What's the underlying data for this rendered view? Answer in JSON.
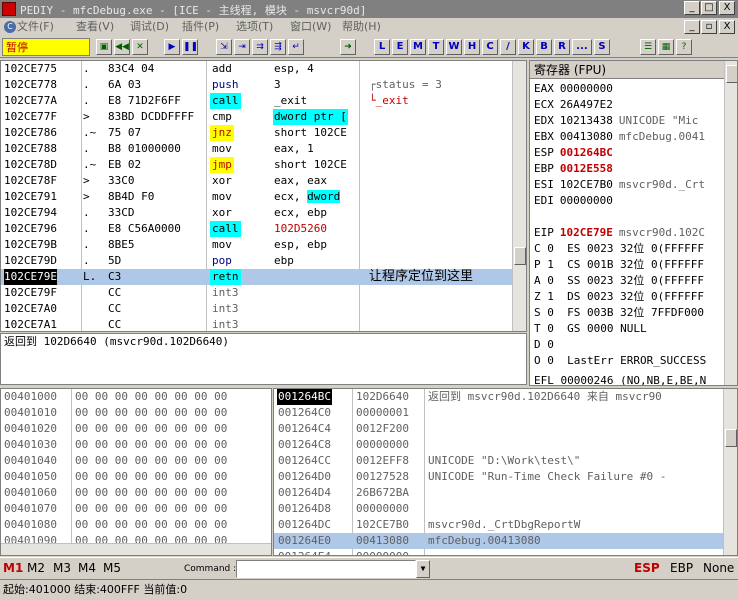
{
  "title": "PEDIY - mfcDebug.exe - [ICE - 主线程, 模块 - msvcr90d]",
  "window_buttons": [
    "_",
    "□",
    "X"
  ],
  "child_buttons": [
    "_",
    "▫",
    "X"
  ],
  "menu": [
    {
      "icon": "C",
      "label": "文件(F)"
    },
    {
      "icon": "",
      "label": "查看(V)"
    },
    {
      "icon": "",
      "label": "调试(D)"
    },
    {
      "icon": "",
      "label": "插件(P)"
    },
    {
      "icon": "",
      "label": "选项(T)"
    },
    {
      "icon": "",
      "label": "窗口(W)"
    },
    {
      "icon": "",
      "label": "帮助(H)"
    }
  ],
  "status": "暂停",
  "toolbar_letters": [
    "L",
    "E",
    "M",
    "T",
    "W",
    "H",
    "C",
    "/",
    "K",
    "B",
    "R",
    "...",
    "S"
  ],
  "disasm": [
    {
      "addr": "102CE775",
      "mk": ".",
      "hex": "83C4 04",
      "mn": "add",
      "op": "esp, 4",
      "mc": "plain",
      "oc": "",
      "cm": ""
    },
    {
      "addr": "102CE778",
      "mk": ".",
      "hex": "6A 03",
      "mn": "push",
      "op": "3",
      "mc": "push",
      "oc": "",
      "cm": "┌status = 3"
    },
    {
      "addr": "102CE77A",
      "mk": ".",
      "hex": "E8 71D2F6FF",
      "mn": "call",
      "op": "_exit",
      "mc": "call",
      "oc": "",
      "cm": "└_exit"
    },
    {
      "addr": "102CE77F",
      "mk": ">",
      "hex": "83BD DCDDFFFF",
      "mn": "cmp",
      "op": "dword ptr [",
      "mc": "plain",
      "oc": "hl",
      "cm": ""
    },
    {
      "addr": "102CE786",
      "mk": ".~",
      "hex": "75 07",
      "mn": "jnz",
      "op": "short 102CE",
      "mc": "jump",
      "oc": "",
      "cm": ""
    },
    {
      "addr": "102CE788",
      "mk": ".",
      "hex": "B8 01000000",
      "mn": "mov",
      "op": "eax, 1",
      "mc": "plain",
      "oc": "",
      "cm": ""
    },
    {
      "addr": "102CE78D",
      "mk": ".~",
      "hex": "EB 02",
      "mn": "jmp",
      "op": "short 102CE",
      "mc": "jump",
      "oc": "",
      "cm": ""
    },
    {
      "addr": "102CE78F",
      "mk": ">",
      "hex": "33C0",
      "mn": "xor",
      "op": "eax, eax",
      "mc": "plain",
      "oc": "",
      "cm": ""
    },
    {
      "addr": "102CE791",
      "mk": ">",
      "hex": "8B4D F0",
      "mn": "mov",
      "op": "ecx, dword",
      "mc": "plain",
      "oc": "hlpart",
      "cm": ""
    },
    {
      "addr": "102CE794",
      "mk": ".",
      "hex": "33CD",
      "mn": "xor",
      "op": "ecx, ebp",
      "mc": "plain",
      "oc": "",
      "cm": ""
    },
    {
      "addr": "102CE796",
      "mk": ".",
      "hex": "E8 C56A0000",
      "mn": "call",
      "op": "102D5260",
      "mc": "call",
      "oc": "red",
      "cm": ""
    },
    {
      "addr": "102CE79B",
      "mk": ".",
      "hex": "8BE5",
      "mn": "mov",
      "op": "esp, ebp",
      "mc": "plain",
      "oc": "",
      "cm": ""
    },
    {
      "addr": "102CE79D",
      "mk": ".",
      "hex": "5D",
      "mn": "pop",
      "op": "ebp",
      "mc": "push",
      "oc": "",
      "cm": ""
    },
    {
      "addr": "102CE79E",
      "mk": "L.",
      "hex": "C3",
      "mn": "retn",
      "op": "",
      "mc": "ret",
      "oc": "",
      "cm": "让程序定位到这里"
    },
    {
      "addr": "102CE79F",
      "mk": "",
      "hex": "CC",
      "mn": "int3",
      "op": "",
      "mc": "gray",
      "oc": "",
      "cm": ""
    },
    {
      "addr": "102CE7A0",
      "mk": "",
      "hex": "CC",
      "mn": "int3",
      "op": "",
      "mc": "gray",
      "oc": "",
      "cm": ""
    },
    {
      "addr": "102CE7A1",
      "mk": "",
      "hex": "CC",
      "mn": "int3",
      "op": "",
      "mc": "gray",
      "oc": "",
      "cm": ""
    }
  ],
  "info_line": "返回到 102D6640 (msvcr90d.102D6640)",
  "registers_title": "寄存器 (FPU)",
  "registers": [
    {
      "name": "EAX",
      "value": "00000000",
      "comment": "",
      "vc": ""
    },
    {
      "name": "ECX",
      "value": "26A497E2",
      "comment": "",
      "vc": ""
    },
    {
      "name": "EDX",
      "value": "10213438",
      "comment": "UNICODE \"Mic",
      "vc": ""
    },
    {
      "name": "EBX",
      "value": "00413080",
      "comment": "mfcDebug.0041",
      "vc": ""
    },
    {
      "name": "ESP",
      "value": "001264BC",
      "comment": "",
      "vc": "red"
    },
    {
      "name": "EBP",
      "value": "0012E558",
      "comment": "",
      "vc": "red"
    },
    {
      "name": "ESI",
      "value": "102CE7B0",
      "comment": "msvcr90d._Crt",
      "vc": ""
    },
    {
      "name": "EDI",
      "value": "00000000",
      "comment": "",
      "vc": ""
    },
    {
      "name": "",
      "value": "",
      "comment": "",
      "vc": ""
    },
    {
      "name": "EIP",
      "value": "102CE79E",
      "comment": "msvcr90d.102C",
      "vc": "red"
    }
  ],
  "flags": [
    "C 0  ES 0023 32位 0(FFFFFF",
    "P 1  CS 001B 32位 0(FFFFFF",
    "A 0  SS 0023 32位 0(FFFFFF",
    "Z 1  DS 0023 32位 0(FFFFFF",
    "S 0  FS 003B 32位 7FFDF000",
    "T 0  GS 0000 NULL",
    "D 0",
    "O 0  LastErr ERROR_SUCCESS"
  ],
  "efl": "EFL 00000246 (NO,NB,E,BE,N",
  "dump": [
    {
      "addr": "00401000",
      "bytes": "00 00 00 00 00 00 00 00"
    },
    {
      "addr": "00401010",
      "bytes": "00 00 00 00 00 00 00 00"
    },
    {
      "addr": "00401020",
      "bytes": "00 00 00 00 00 00 00 00"
    },
    {
      "addr": "00401030",
      "bytes": "00 00 00 00 00 00 00 00"
    },
    {
      "addr": "00401040",
      "bytes": "00 00 00 00 00 00 00 00"
    },
    {
      "addr": "00401050",
      "bytes": "00 00 00 00 00 00 00 00"
    },
    {
      "addr": "00401060",
      "bytes": "00 00 00 00 00 00 00 00"
    },
    {
      "addr": "00401070",
      "bytes": "00 00 00 00 00 00 00 00"
    },
    {
      "addr": "00401080",
      "bytes": "00 00 00 00 00 00 00 00"
    },
    {
      "addr": "00401090",
      "bytes": "00 00 00 00 00 00 00 00"
    }
  ],
  "stack": [
    {
      "addr": "001264BC",
      "value": "102D6640",
      "comment": "返回到 msvcr90d.102D6640 来自 msvcr90"
    },
    {
      "addr": "001264C0",
      "value": "00000001",
      "comment": ""
    },
    {
      "addr": "001264C4",
      "value": "0012F200",
      "comment": ""
    },
    {
      "addr": "001264C8",
      "value": "00000000",
      "comment": ""
    },
    {
      "addr": "001264CC",
      "value": "0012EFF8",
      "comment": "UNICODE \"D:\\Work\\test\\\""
    },
    {
      "addr": "001264D0",
      "value": "00127528",
      "comment": "UNICODE \"Run-Time Check Failure #0 -"
    },
    {
      "addr": "001264D4",
      "value": "26B672BA",
      "comment": ""
    },
    {
      "addr": "001264D8",
      "value": "00000000",
      "comment": ""
    },
    {
      "addr": "001264DC",
      "value": "102CE7B0",
      "comment": "msvcr90d._CrtDbgReportW"
    },
    {
      "addr": "001264E0",
      "value": "00413080",
      "comment": "mfcDebug.00413080"
    },
    {
      "addr": "001264E4",
      "value": "00000000",
      "comment": ""
    }
  ],
  "memory_tabs": [
    "M1",
    "M2",
    "M3",
    "M4",
    "M5"
  ],
  "command_label": "Command :",
  "command_value": "",
  "reg_tabs": [
    "ESP",
    "EBP",
    "None"
  ],
  "statusbar": "起始:401000 结束:400FFF 当前值:0"
}
